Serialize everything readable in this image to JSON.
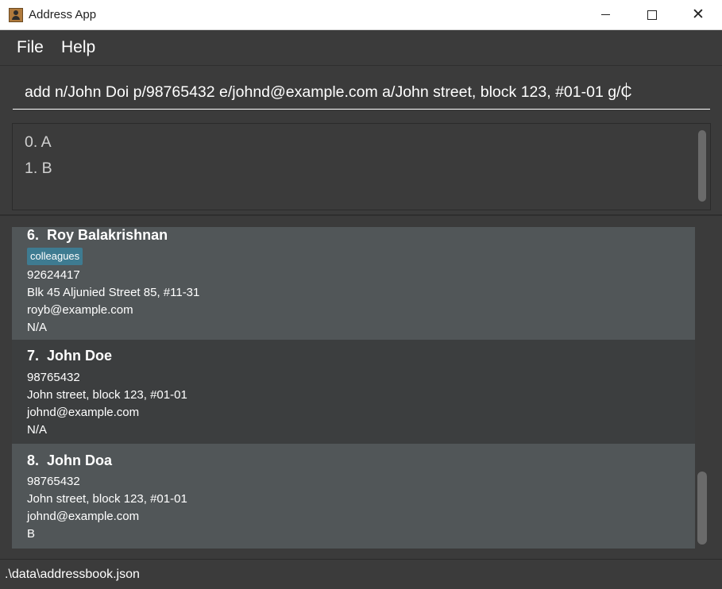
{
  "window": {
    "title": "Address App",
    "icon": "address-book-icon",
    "controls": {
      "minimize": "minimize-icon",
      "maximize": "maximize-icon",
      "close": "close-icon"
    }
  },
  "menu": {
    "file": "File",
    "help": "Help"
  },
  "command": {
    "value": "add n/John Doi p/98765432 e/johnd@example.com a/John street, block 123, #01-01 g/C"
  },
  "results": [
    "0. A",
    "1. B"
  ],
  "persons": [
    {
      "index": "6.",
      "name": "Roy Balakrishnan",
      "tags": [
        "colleagues"
      ],
      "phone": "92624417",
      "address": "Blk 45 Aljunied Street 85, #11-31",
      "email": "royb@example.com",
      "extra": "N/A"
    },
    {
      "index": "7.",
      "name": "John Doe",
      "tags": [],
      "phone": "98765432",
      "address": "John street, block 123, #01-01",
      "email": "johnd@example.com",
      "extra": "N/A"
    },
    {
      "index": "8.",
      "name": "John Doa",
      "tags": [],
      "phone": "98765432",
      "address": "John street, block 123, #01-01",
      "email": "johnd@example.com",
      "extra": "B"
    }
  ],
  "status": {
    "path": ".\\data\\addressbook.json"
  },
  "colors": {
    "accent_tag": "#3e7b91",
    "card_light": "#515658",
    "card_dark": "#3c3e3f",
    "background": "#3b3b3b"
  }
}
